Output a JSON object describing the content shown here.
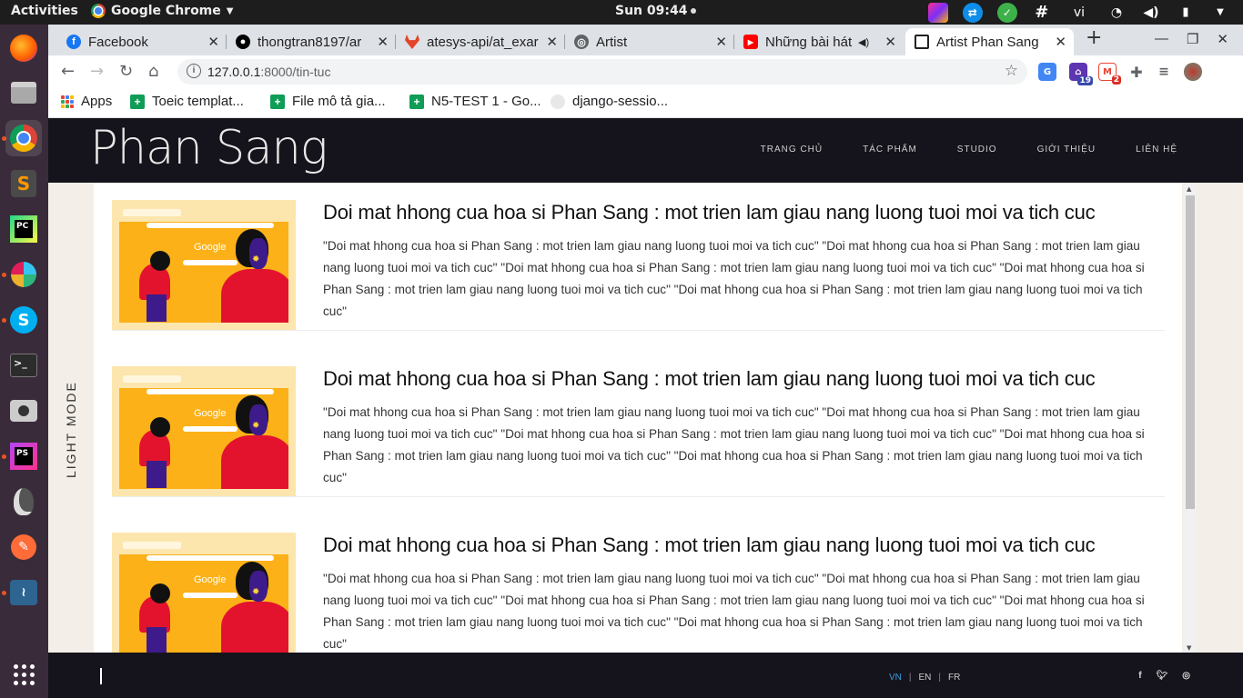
{
  "system": {
    "activities": "Activities",
    "app_name": "Google Chrome",
    "clock": "Sun 09:44",
    "lang": "vi"
  },
  "browser": {
    "tabs": [
      {
        "title": "Facebook",
        "favicon": "facebook-icon",
        "color": "#1877f2"
      },
      {
        "title": "thongtran8197/ar",
        "favicon": "github-icon",
        "color": "#000000"
      },
      {
        "title": "atesys-api/at_exar",
        "favicon": "gitlab-icon",
        "color": "#e24329"
      },
      {
        "title": "Artist",
        "favicon": "globe-icon",
        "color": "#5f6368"
      },
      {
        "title": "Những bài hát",
        "favicon": "youtube-icon",
        "color": "#ff0000"
      },
      {
        "title": "Artist Phan Sang",
        "favicon": "page-icon",
        "color": "#202124"
      }
    ],
    "url_host": "127.0.0.1",
    "url_path": ":8000/tin-tuc",
    "extension_badges": {
      "first": "19",
      "second": "2"
    },
    "bookmarks": [
      "Apps",
      "Toeic templat...",
      "File mô tả gia...",
      "N5-TEST 1 - Go...",
      "django-sessio..."
    ]
  },
  "site": {
    "logo": "Phan Sang",
    "nav": [
      "TRANG CHỦ",
      "TÁC PHẨM",
      "STUDIO",
      "GIỚI THIỆU",
      "LIÊN HỆ"
    ],
    "light_mode": "LIGHT MODE",
    "thumbnail_logo": "Google",
    "articles": [
      {
        "title": "Doi mat hhong cua hoa si Phan Sang : mot trien lam giau nang luong tuoi moi va tich cuc",
        "excerpt": "\"Doi mat hhong cua hoa si Phan Sang : mot trien lam giau nang luong tuoi moi va tich cuc\" \"Doi mat hhong cua hoa si Phan Sang : mot trien lam giau nang luong tuoi moi va tich cuc\" \"Doi mat hhong cua hoa si Phan Sang : mot trien lam giau nang luong tuoi moi va tich cuc\" \"Doi mat hhong cua hoa si Phan Sang : mot trien lam giau nang luong tuoi moi va tich cuc\" \"Doi mat hhong cua hoa si Phan Sang : mot trien lam giau nang luong tuoi moi va tich cuc\""
      },
      {
        "title": "Doi mat hhong cua hoa si Phan Sang : mot trien lam giau nang luong tuoi moi va tich cuc",
        "excerpt": "\"Doi mat hhong cua hoa si Phan Sang : mot trien lam giau nang luong tuoi moi va tich cuc\" \"Doi mat hhong cua hoa si Phan Sang : mot trien lam giau nang luong tuoi moi va tich cuc\" \"Doi mat hhong cua hoa si Phan Sang : mot trien lam giau nang luong tuoi moi va tich cuc\" \"Doi mat hhong cua hoa si Phan Sang : mot trien lam giau nang luong tuoi moi va tich cuc\" \"Doi mat hhong cua hoa si Phan Sang : mot trien lam giau nang luong tuoi moi va tich cuc\""
      },
      {
        "title": "Doi mat hhong cua hoa si Phan Sang : mot trien lam giau nang luong tuoi moi va tich cuc",
        "excerpt": "\"Doi mat hhong cua hoa si Phan Sang : mot trien lam giau nang luong tuoi moi va tich cuc\" \"Doi mat hhong cua hoa si Phan Sang : mot trien lam giau nang luong tuoi moi va tich cuc\" \"Doi mat hhong cua hoa si Phan Sang : mot trien lam giau nang luong tuoi moi va tich cuc\" \"Doi mat hhong cua hoa si Phan Sang : mot trien lam giau nang luong tuoi moi va tich cuc\" \"Doi mat hhong cua hoa si Phan Sang : mot trien lam giau nang luong tuoi moi va tich cuc\""
      }
    ],
    "languages": [
      "VN",
      "EN",
      "FR"
    ],
    "active_language": "VN",
    "social": [
      "facebook-icon",
      "twitter-icon",
      "instagram-icon"
    ]
  }
}
